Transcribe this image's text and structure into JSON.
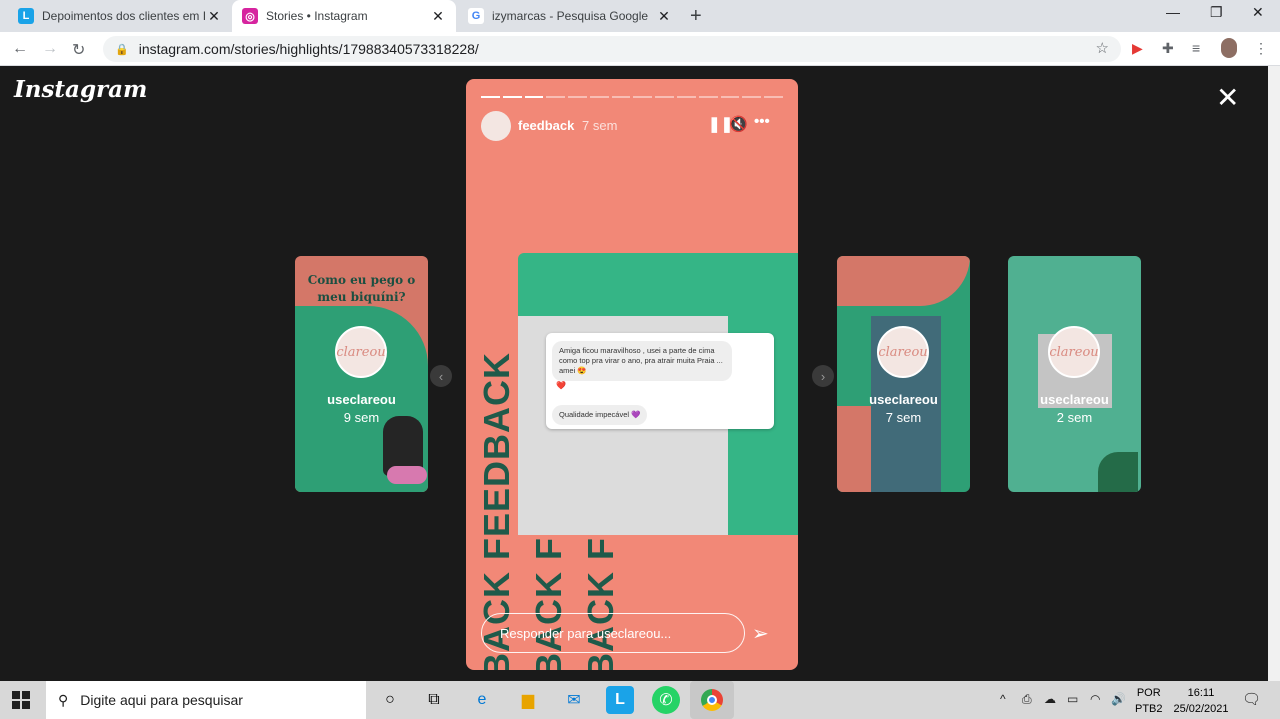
{
  "browser": {
    "tabs": [
      {
        "title": "Depoimentos dos clientes em Izy",
        "favicon": "L"
      },
      {
        "title": "Stories • Instagram",
        "favicon": "◎"
      },
      {
        "title": "izymarcas - Pesquisa Google",
        "favicon": "G"
      }
    ],
    "url": "instagram.com/stories/highlights/17988340573318228/"
  },
  "instagram": {
    "logo": "Instagram",
    "left_story": {
      "title": "Como eu pego o meu biquíni?",
      "avatar_text": "clareou",
      "username": "useclareou",
      "time": "9 sem"
    },
    "right_story_1": {
      "avatar_text": "clareou",
      "username": "useclareou",
      "time": "7 sem"
    },
    "right_story_2": {
      "avatar_text": "clareou",
      "username": "useclareou",
      "time": "2 sem"
    },
    "story": {
      "username": "feedback",
      "time": "7 sem",
      "bg_word": "FEEDBACK",
      "bg_word_short": "BACK FEEDBACK",
      "message_1": "Amiga ficou maravilhoso , usei a parte de cima como top pra virar o ano, pra atrair muita Praia ... amei 😍",
      "reaction": "❤️",
      "message_2": "Qualidade impecável 💜",
      "reply_placeholder": "Responder para useclareou..."
    }
  },
  "taskbar": {
    "search_placeholder": "Digite aqui para pesquisar",
    "lang_top": "POR",
    "lang_bottom": "PTB2",
    "time": "16:11",
    "date": "25/02/2021"
  },
  "colors": {
    "accent": "#f28877",
    "green": "#35b586",
    "dark_green": "#1f5a4a"
  }
}
